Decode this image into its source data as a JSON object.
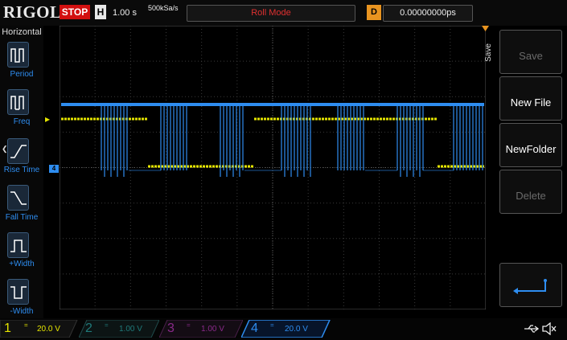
{
  "header": {
    "logo": "RIGOL",
    "run_state": "STOP",
    "timebase_badge": "H",
    "timebase": "1.00 s",
    "sample_rate": "500kSa/s",
    "mode": "Roll Mode",
    "delay_badge": "D",
    "delay": "0.00000000ps"
  },
  "left_menu": {
    "title": "Horizontal",
    "items": [
      {
        "label": "Period",
        "icon": "period-icon"
      },
      {
        "label": "Freq",
        "icon": "frequency-icon"
      },
      {
        "label": "Rise Time",
        "icon": "rise-time-icon"
      },
      {
        "label": "Fall Time",
        "icon": "fall-time-icon"
      },
      {
        "label": "+Width",
        "icon": "positive-width-icon"
      },
      {
        "label": "-Width",
        "icon": "negative-width-icon"
      }
    ]
  },
  "right_menu": {
    "title": "Save",
    "buttons": [
      {
        "label": "Save",
        "enabled": false
      },
      {
        "label": "New File",
        "enabled": true
      },
      {
        "label": "NewFolder",
        "enabled": true
      },
      {
        "label": "Delete",
        "enabled": false
      },
      {
        "label": "",
        "icon": "enter-icon",
        "enabled": true
      }
    ]
  },
  "channels": [
    {
      "number": "1",
      "coupling": "=",
      "scale": "20.0 V",
      "color": "#e6e600",
      "active": true
    },
    {
      "number": "2",
      "coupling": "=",
      "scale": "1.00 V",
      "color": "#1f7a7a",
      "active": false
    },
    {
      "number": "3",
      "coupling": "=",
      "scale": "1.00 V",
      "color": "#8a2a8a",
      "active": false
    },
    {
      "number": "4",
      "coupling": "=",
      "scale": "20.0 V",
      "color": "#2e8df0",
      "active": true
    }
  ],
  "markers": {
    "ch4_ref": "4",
    "ch1_ref": "▸"
  },
  "colors": {
    "ch1": "#e6e600",
    "ch4": "#2e8df0",
    "stop": "#d21010",
    "delay_badge": "#e89420",
    "roll_mode_text": "#e03030"
  },
  "status_icons": [
    "usb-icon",
    "speaker-mute-icon"
  ]
}
